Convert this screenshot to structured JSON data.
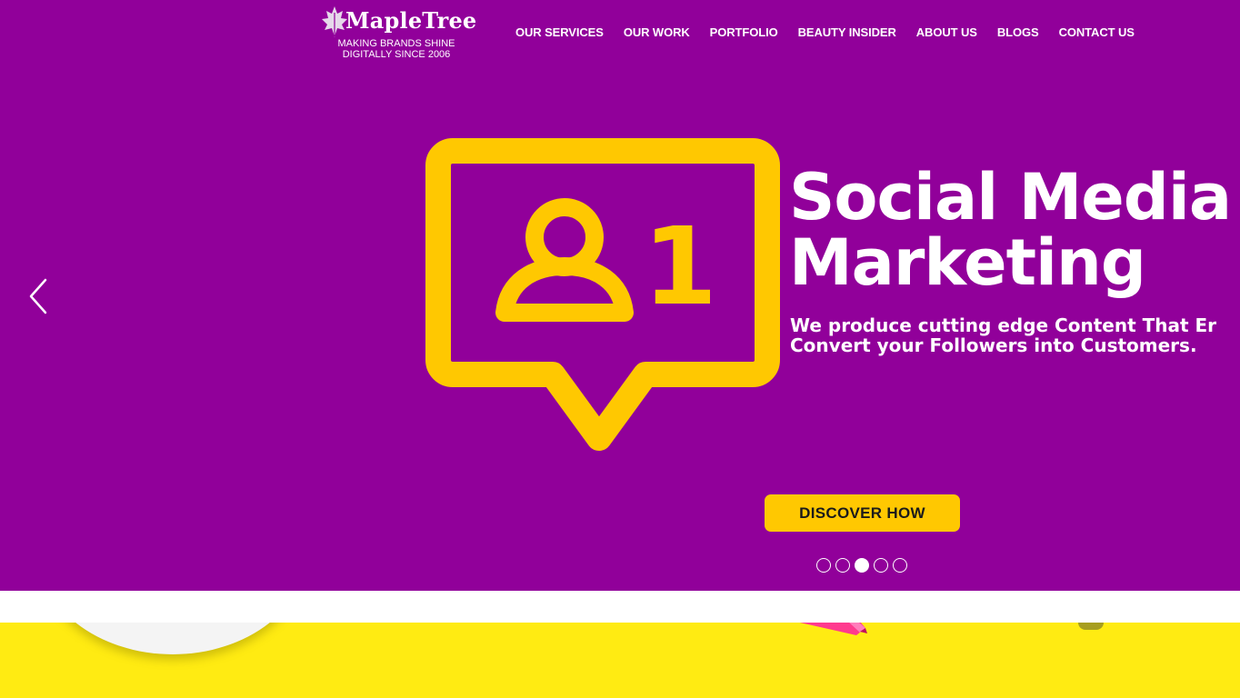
{
  "header": {
    "logo": {
      "name": "MapleTree",
      "tagline_line1": "MAKING BRANDS SHINE",
      "tagline_line2": "DIGITALLY SINCE 2006"
    },
    "nav": [
      {
        "label": "OUR SERVICES"
      },
      {
        "label": "OUR WORK"
      },
      {
        "label": "PORTFOLIO"
      },
      {
        "label": "BEAUTY INSIDER"
      },
      {
        "label": "ABOUT US"
      },
      {
        "label": "BLOGS"
      },
      {
        "label": "CONTACT US"
      }
    ]
  },
  "slider": {
    "background_color": "#91009a",
    "accent_color": "#ffc801",
    "icon": "follower-notification-icon",
    "icon_count": "1",
    "title_line1": "Social Media",
    "title_line2": "Marketing",
    "subtitle_line1": "We produce cutting edge Content That Er",
    "subtitle_line2": "Convert your Followers into Customers.",
    "cta_label": "DISCOVER HOW",
    "prev_icon": "chevron-left-icon",
    "dots_total": 5,
    "active_dot": 3
  },
  "next_section": {
    "background_color": "#ffeb12"
  }
}
